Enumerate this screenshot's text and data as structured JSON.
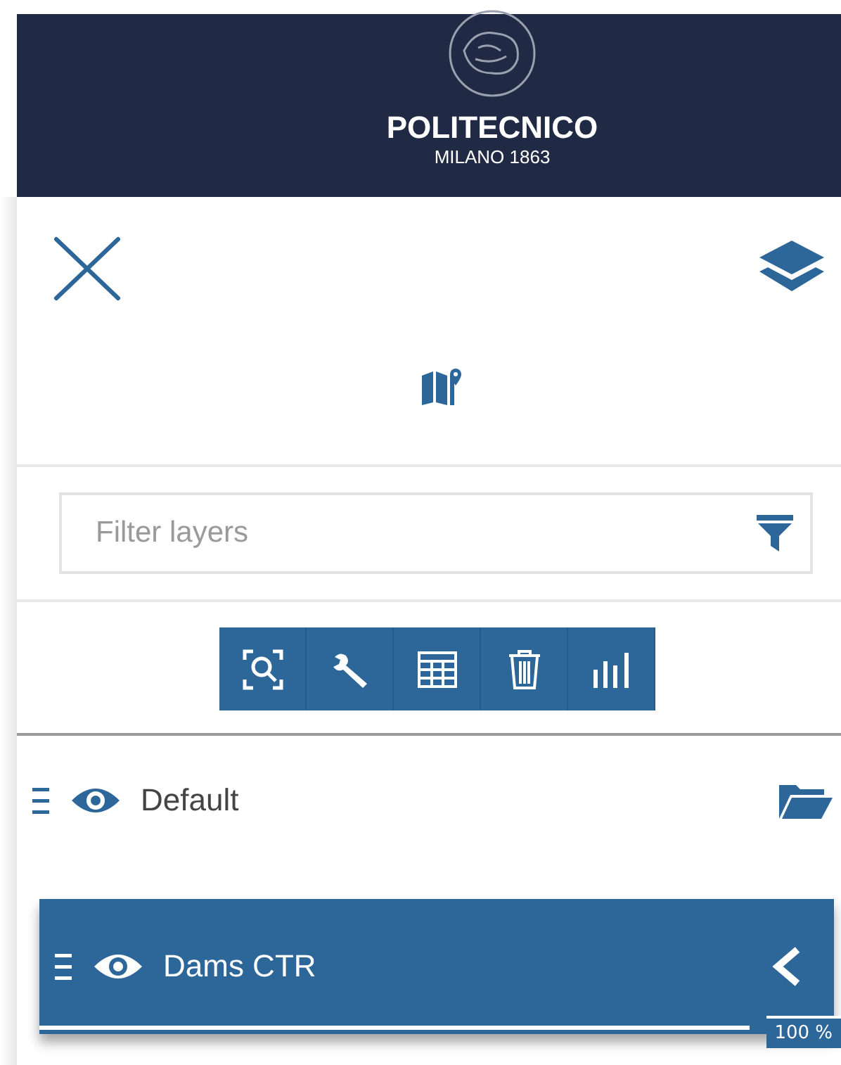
{
  "header": {
    "logo_title": "POLITECNICO",
    "logo_subtitle": "MILANO 1863"
  },
  "filter": {
    "placeholder": "Filter layers"
  },
  "toolbar": [
    {
      "kind": "zoom"
    },
    {
      "kind": "tools"
    },
    {
      "kind": "table"
    },
    {
      "kind": "delete"
    },
    {
      "kind": "chart"
    }
  ],
  "layers": [
    {
      "kind": "group",
      "name": "Default",
      "selected": false
    },
    {
      "kind": "layer",
      "name": "Dams CTR",
      "selected": true,
      "opacity": {
        "reading": "100 %"
      }
    }
  ]
}
